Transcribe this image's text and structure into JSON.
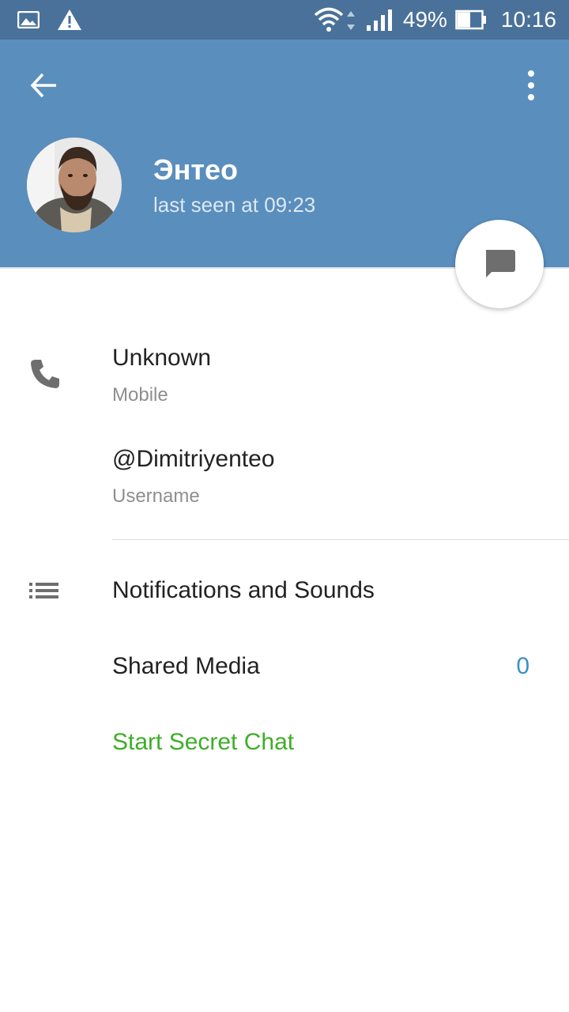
{
  "status_bar": {
    "left_icons": [
      "image-notification-icon",
      "warning-icon"
    ],
    "right_icons": [
      "wifi-icon",
      "signal-icon",
      "battery-icon"
    ],
    "battery": "49%",
    "time": "10:16"
  },
  "header": {
    "name": "Энтео",
    "last_seen": "last seen at 09:23",
    "icons": [
      "back-arrow-icon",
      "more-vert-icon",
      "message-icon"
    ],
    "colors": {
      "header_bg": "#5a8ebd",
      "status_bar_bg": "#4a7199"
    }
  },
  "info": {
    "phone": {
      "value": "Unknown",
      "label": "Mobile",
      "icon": "phone-icon"
    },
    "username": {
      "value": "@Dimitriyenteo",
      "label": "Username"
    }
  },
  "actions": {
    "notifications": {
      "label": "Notifications and Sounds",
      "icon": "list-icon"
    },
    "shared_media": {
      "label": "Shared Media",
      "count": "0"
    },
    "secret_chat": {
      "label": "Start Secret Chat"
    }
  },
  "colors": {
    "count": "#3a8fcc",
    "secret_chat": "#3fae29"
  }
}
